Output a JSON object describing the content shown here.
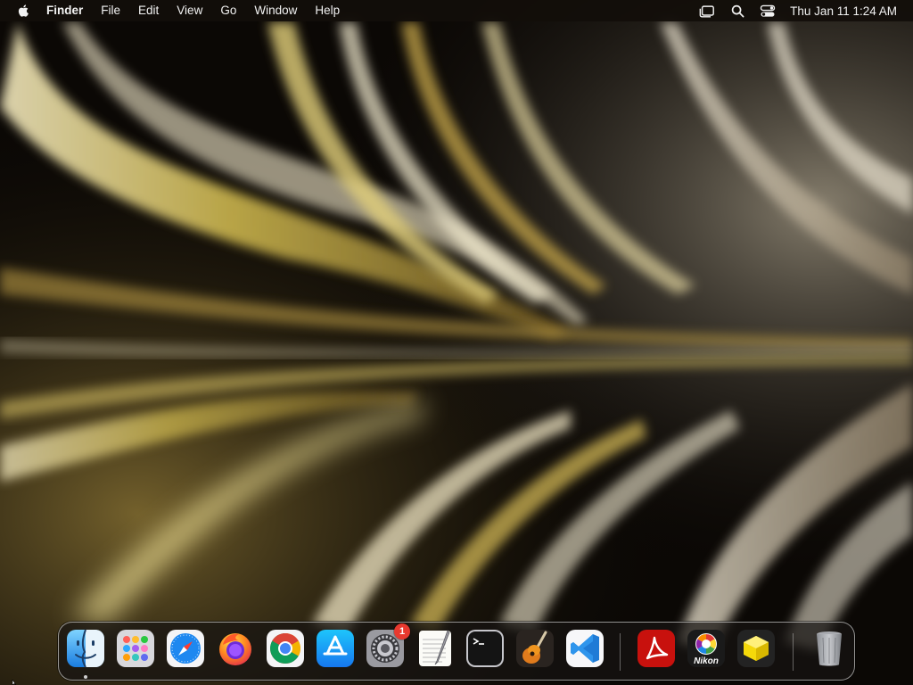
{
  "menubar": {
    "app_name": "Finder",
    "menus": [
      "File",
      "Edit",
      "View",
      "Go",
      "Window",
      "Help"
    ],
    "status_icons": [
      "window-switch-icon",
      "search-icon",
      "control-center-icon"
    ],
    "clock": "Thu Jan 11  1:24 AM"
  },
  "dock": {
    "apps": [
      {
        "name": "Finder",
        "icon": "finder-icon",
        "running": true
      },
      {
        "name": "Launchpad",
        "icon": "launchpad-icon"
      },
      {
        "name": "Safari",
        "icon": "safari-icon"
      },
      {
        "name": "Firefox",
        "icon": "firefox-icon"
      },
      {
        "name": "Google Chrome",
        "icon": "chrome-icon"
      },
      {
        "name": "App Store",
        "icon": "app-store-icon"
      },
      {
        "name": "System Settings",
        "icon": "system-settings-icon",
        "badge": "1"
      },
      {
        "name": "TextEdit",
        "icon": "textedit-icon"
      },
      {
        "name": "Terminal",
        "icon": "terminal-icon"
      },
      {
        "name": "GarageBand",
        "icon": "garageband-icon"
      },
      {
        "name": "Visual Studio Code",
        "icon": "vscode-icon"
      }
    ],
    "apps_recent": [
      {
        "name": "Adobe Acrobat",
        "icon": "acrobat-icon"
      },
      {
        "name": "Nikon",
        "icon": "nikon-icon",
        "label": "Nikon"
      },
      {
        "name": "Yellow Cube App",
        "icon": "yellow-cube-icon"
      }
    ],
    "trash": {
      "name": "Trash",
      "icon": "trash-icon"
    }
  },
  "colors": {
    "menubar_bg": "#120e0a",
    "badge": "#e8392f",
    "wallpaper_gold": "#d9c76a",
    "wallpaper_cream": "#efe6cf"
  }
}
